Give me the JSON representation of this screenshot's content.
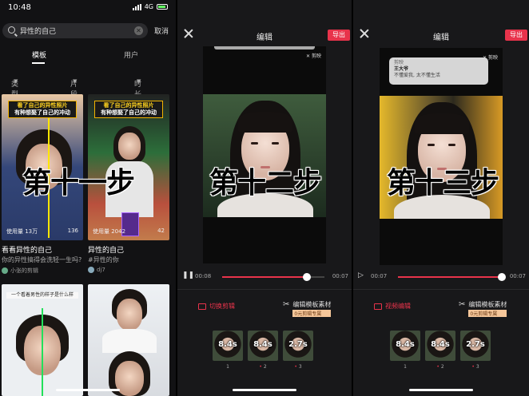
{
  "panel1": {
    "status": {
      "time": "10:48",
      "network": "4G"
    },
    "search": {
      "query": "异性的自己",
      "cancel": "取消"
    },
    "tabs": [
      "模板",
      "用户"
    ],
    "filters": [
      "类型",
      "片段数",
      "时长"
    ],
    "cards": [
      {
        "banner_top": "看了自己的异性照片",
        "banner_bottom": "有种想娶了自己的冲动",
        "stats_left": "使用量 13万",
        "stats_right": "136",
        "title": "看看异性的自己",
        "desc": "你的异性搞得会洗轻一生吗?",
        "author": "小张的剪辑"
      },
      {
        "banner_top": "看了自己的异性照片",
        "banner_bottom": "有种想娶了自己的冲动",
        "stats_left": "使用量 2042",
        "stats_right": "42",
        "title": "异性的自己",
        "tag": "#异性的你",
        "author": "dj7"
      },
      {
        "banner": "一个看着男性的样子是什么样"
      },
      {}
    ]
  },
  "panel2": {
    "title": "编辑",
    "export": "导出",
    "watermark": "剪映",
    "time_current": "00:08",
    "time_end": "00:07",
    "progress": 0.83,
    "tool_a": "切换剪辑",
    "tool_b": "编辑模板素材",
    "tool_b_sub": "0元剪辑专属",
    "clips": [
      {
        "dur": "8.4s",
        "num": "1"
      },
      {
        "dur": "8.4s",
        "num": "2"
      },
      {
        "dur": "2.7s",
        "num": "3"
      }
    ]
  },
  "panel3": {
    "title": "编辑",
    "export": "导出",
    "watermark": "剪映",
    "notif_app": "剪映",
    "notif_title": "王大爷",
    "notif_msg": "不懂爱我, 太不懂生活",
    "time_current": "00:07",
    "time_end": "00:07",
    "progress": 1.0,
    "tool_a": "视频编辑",
    "tool_b": "编辑模板素材",
    "tool_b_sub": "0元剪辑专属",
    "clips": [
      {
        "dur": "8.4s",
        "num": "1"
      },
      {
        "dur": "8.4s",
        "num": "2"
      },
      {
        "dur": "2.7s",
        "num": "3"
      }
    ]
  },
  "overlays": [
    "第十一步",
    "第十二步",
    "第十三步"
  ]
}
